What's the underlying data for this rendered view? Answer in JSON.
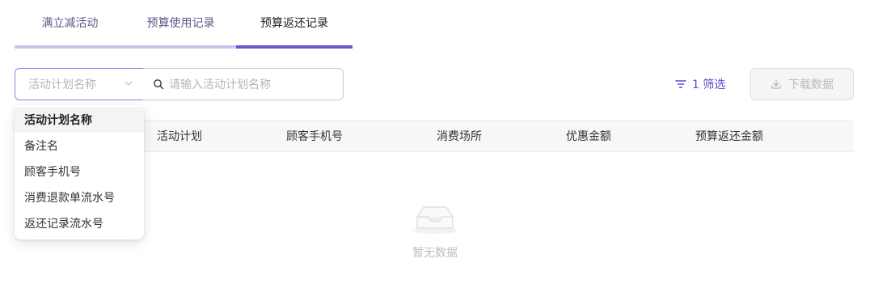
{
  "tabs": [
    {
      "label": "满立减活动",
      "active": false
    },
    {
      "label": "预算使用记录",
      "active": false
    },
    {
      "label": "预算返还记录",
      "active": true
    }
  ],
  "filter": {
    "select_placeholder": "活动计划名称",
    "search_placeholder": "请输入活动计划名称",
    "filter_label": "1 筛选",
    "download_label": "下载数据"
  },
  "dropdown": {
    "items": [
      {
        "label": "活动计划名称",
        "selected": true
      },
      {
        "label": "备注名",
        "selected": false
      },
      {
        "label": "顾客手机号",
        "selected": false
      },
      {
        "label": "消费退款单流水号",
        "selected": false
      },
      {
        "label": "返还记录流水号",
        "selected": false
      }
    ]
  },
  "table": {
    "columns": [
      "活动计划",
      "顾客手机号",
      "消费场所",
      "优惠金额",
      "预算返还金额"
    ]
  },
  "empty": {
    "text": "暂无数据"
  },
  "colors": {
    "accent": "#6a57d0",
    "tab_underline": "#cfc3ea",
    "disabled_bg": "#f5f5f5"
  },
  "icons": {
    "search": "search-icon",
    "filter": "filter-icon",
    "download": "download-icon",
    "chevron": "chevron-down-icon",
    "empty": "inbox-icon"
  }
}
